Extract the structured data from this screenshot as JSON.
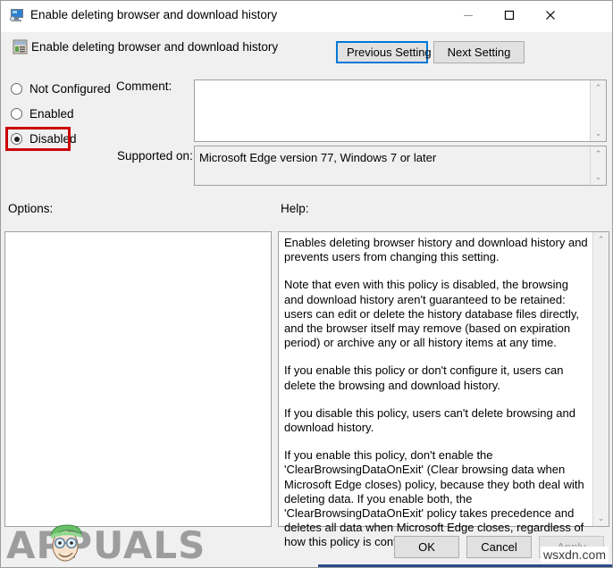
{
  "window": {
    "title": "Enable deleting browser and download history",
    "icon": "computer-monitor-icon",
    "controls": {
      "minimize": "minimize-icon",
      "maximize": "maximize-icon",
      "close": "close-icon"
    }
  },
  "header": {
    "policy_icon": "policy-document-icon",
    "policy_name": "Enable deleting browser and download history",
    "previous_setting": "Previous Setting",
    "next_setting": "Next Setting"
  },
  "state_options": [
    {
      "label": "Not Configured",
      "selected": false
    },
    {
      "label": "Enabled",
      "selected": false
    },
    {
      "label": "Disabled",
      "selected": true
    }
  ],
  "fields": {
    "comment_label": "Comment:",
    "comment_value": "",
    "supported_label": "Supported on:",
    "supported_value": "Microsoft Edge version 77, Windows 7 or later"
  },
  "sections": {
    "options_label": "Options:",
    "help_label": "Help:",
    "options_content": ""
  },
  "help": {
    "paragraphs": [
      "Enables deleting browser history and download history and prevents users from changing this setting.",
      "Note that even with this policy is disabled, the browsing and download history aren't guaranteed to be retained: users can edit or delete the history database files directly, and the browser itself may remove (based on expiration period) or archive any or all history items at any time.",
      "If you enable this policy or don't configure it, users can delete the browsing and download history.",
      "If you disable this policy, users can't delete browsing and download history.",
      "If you enable this policy, don't enable the 'ClearBrowsingDataOnExit' (Clear browsing data when Microsoft Edge closes) policy, because they both deal with deleting data. If you enable both, the 'ClearBrowsingDataOnExit' policy takes precedence and deletes all data when Microsoft Edge closes, regardless of how this policy is configured."
    ]
  },
  "buttons": {
    "ok": "OK",
    "cancel": "Cancel",
    "apply": "Apply"
  },
  "watermarks": {
    "appuals": "APPUALS",
    "wsxdn": "wsxdn.com"
  },
  "colors": {
    "focus_blue": "#0078d7",
    "annotation_red": "#cc0000",
    "dialog_gray": "#f0f0f0",
    "disabled_text": "#9a9a9a"
  },
  "scroll_icons": {
    "up": "⌃",
    "down": "⌄"
  }
}
